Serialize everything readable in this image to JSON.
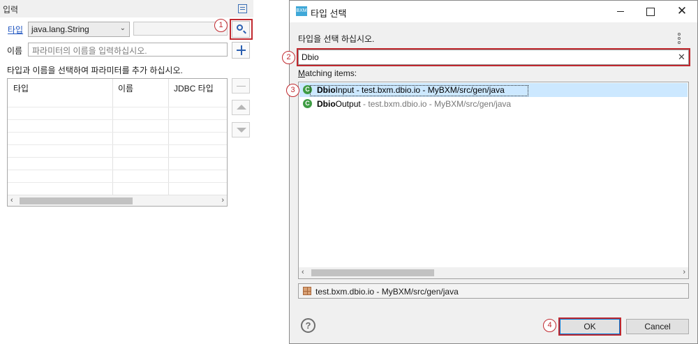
{
  "left_panel": {
    "title": "입력",
    "type_label": "타입",
    "type_value": "java.lang.String",
    "name_label": "이름",
    "name_placeholder": "파라미터의 이름을 입력하십시오.",
    "instruction": "타입과 이름을 선택하여 파라미터를 추가 하십시오.",
    "table": {
      "columns": [
        "타입",
        "이름",
        "JDBC 타입"
      ],
      "rows": []
    }
  },
  "markers": [
    "1",
    "2",
    "3",
    "4"
  ],
  "dialog": {
    "app_icon_text": "BXM",
    "title": "타입 선택",
    "prompt": "타입을 선택 하십시오.",
    "filter_value": "Dbio",
    "matching_label_mnemonic": "M",
    "matching_label_rest": "atching items:",
    "results": [
      {
        "match": "Dbio",
        "rest": "Input",
        "qualifier": " - test.bxm.dbio.io - MyBXM/src/gen/java",
        "selected": true
      },
      {
        "match": "Dbio",
        "rest": "Output",
        "qualifier": " - test.bxm.dbio.io - MyBXM/src/gen/java",
        "selected": false
      }
    ],
    "location": "test.bxm.dbio.io - MyBXM/src/gen/java",
    "help_glyph": "?",
    "ok_label": "OK",
    "cancel_label": "Cancel"
  },
  "colors": {
    "accent": "#0078d7",
    "selection": "#cce8ff",
    "marker": "#c0282e",
    "class_icon": "#3f9c44"
  }
}
